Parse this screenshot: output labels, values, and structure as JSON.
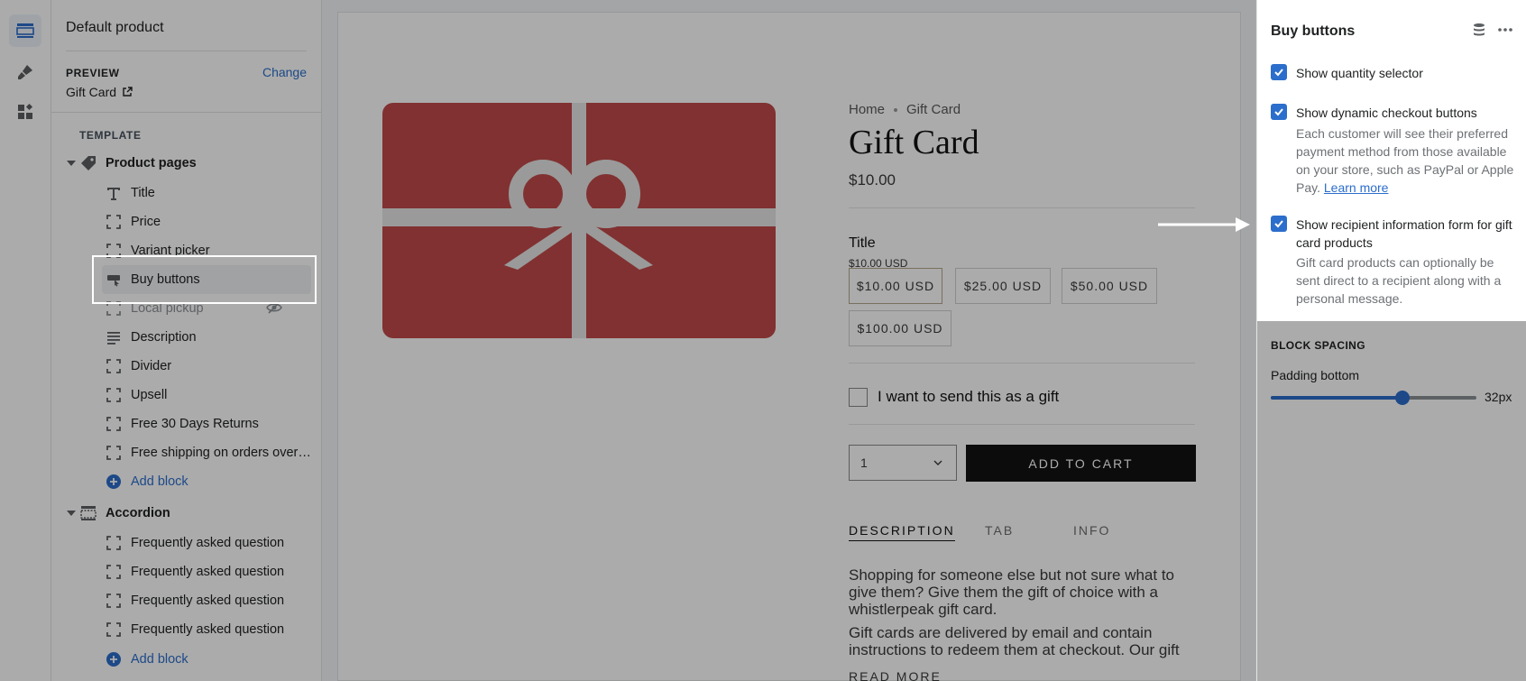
{
  "sidebar": {
    "title": "Default product",
    "preview_label": "PREVIEW",
    "change_label": "Change",
    "preview_value": "Gift Card",
    "template_label": "TEMPLATE",
    "groups": [
      {
        "label": "Product pages",
        "icon": "tag-icon",
        "items": [
          {
            "label": "Title",
            "icon": "text-icon"
          },
          {
            "label": "Price",
            "icon": "block-icon"
          },
          {
            "label": "Variant picker",
            "icon": "block-icon"
          },
          {
            "label": "Buy buttons",
            "icon": "buy-button-icon",
            "selected": true
          },
          {
            "label": "Local pickup",
            "icon": "block-icon",
            "hidden": true
          },
          {
            "label": "Description",
            "icon": "paragraph-icon"
          },
          {
            "label": "Divider",
            "icon": "block-icon"
          },
          {
            "label": "Upsell",
            "icon": "block-icon"
          },
          {
            "label": "Free 30 Days Returns",
            "icon": "block-icon"
          },
          {
            "label": "Free shipping on orders over ...",
            "icon": "block-icon"
          }
        ],
        "add_label": "Add block"
      },
      {
        "label": "Accordion",
        "icon": "accordion-icon",
        "items": [
          {
            "label": "Frequently asked question",
            "icon": "block-icon"
          },
          {
            "label": "Frequently asked question",
            "icon": "block-icon"
          },
          {
            "label": "Frequently asked question",
            "icon": "block-icon"
          },
          {
            "label": "Frequently asked question",
            "icon": "block-icon"
          }
        ],
        "add_label": "Add block"
      }
    ]
  },
  "storefront": {
    "breadcrumb": [
      "Home",
      "Gift Card"
    ],
    "product_title": "Gift Card",
    "price": "$10.00",
    "variant_label": "Title",
    "variant_selected": "$10.00 USD",
    "variants": [
      "$10.00 USD",
      "$25.00 USD",
      "$50.00 USD",
      "$100.00 USD"
    ],
    "gift_checkbox_label": "I want to send this as a gift",
    "quantity": "1",
    "add_to_cart": "ADD TO CART",
    "tabs": [
      "DESCRIPTION",
      "TAB",
      "INFO"
    ],
    "description": [
      "Shopping for someone else but not sure what to give them? Give them the gift of choice with a whistlerpeak gift card.",
      "Gift cards are delivered by email and contain instructions to redeem them at checkout. Our gift"
    ],
    "read_more": "READ MORE",
    "gift_card_color": "#c04a4a",
    "ribbon_color": "#e6e6e6"
  },
  "panel": {
    "title": "Buy buttons",
    "settings": [
      {
        "label": "Show quantity selector",
        "checked": true
      },
      {
        "label": "Show dynamic checkout buttons",
        "checked": true,
        "help": "Each customer will see their preferred payment method from those available on your store, such as PayPal or Apple Pay.",
        "help_link": "Learn more"
      },
      {
        "label": "Show recipient information form for gift card products",
        "checked": true,
        "help": "Gift card products can optionally be sent direct to a recipient along with a personal message."
      }
    ],
    "block_spacing_label": "BLOCK SPACING",
    "padding_label": "Padding bottom",
    "padding_value": "32px",
    "padding_fraction": 0.64
  },
  "colors": {
    "accent": "#2c6ecb",
    "text": "#202223"
  }
}
